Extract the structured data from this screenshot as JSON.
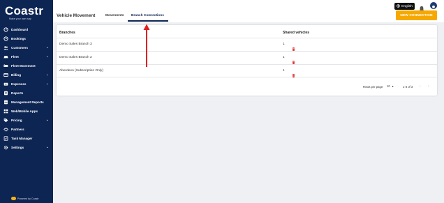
{
  "brand": {
    "name": "Coastr",
    "tagline": "Make your own way"
  },
  "sidebar": {
    "items": [
      {
        "label": "Dashboard",
        "icon": "dashboard-icon",
        "chevron": false
      },
      {
        "label": "Bookings",
        "icon": "bookings-icon",
        "chevron": false
      },
      {
        "label": "Customers",
        "icon": "customers-icon",
        "chevron": true
      },
      {
        "label": "Fleet",
        "icon": "car-icon",
        "chevron": true
      },
      {
        "label": "Fleet Movement",
        "icon": "fleet-movement-icon",
        "chevron": false
      },
      {
        "label": "Billing",
        "icon": "billing-icon",
        "chevron": true
      },
      {
        "label": "Expenses",
        "icon": "expenses-icon",
        "chevron": true
      },
      {
        "label": "Reports",
        "icon": "reports-icon",
        "chevron": false
      },
      {
        "label": "Management Reports",
        "icon": "management-reports-icon",
        "chevron": false
      },
      {
        "label": "Web/Mobile Apps",
        "icon": "apps-icon",
        "chevron": false
      },
      {
        "label": "Pricing",
        "icon": "pricing-tag-icon",
        "chevron": true
      },
      {
        "label": "Partners",
        "icon": "partners-icon",
        "chevron": false
      },
      {
        "label": "Task Manager",
        "icon": "task-manager-icon",
        "chevron": false
      },
      {
        "label": "Settings",
        "icon": "gear-icon",
        "chevron": true
      }
    ],
    "powered_by": "Powered by Coastr"
  },
  "topbar": {
    "language": "English"
  },
  "header": {
    "title": "Vehicle Movement",
    "tabs": [
      {
        "label": "Movements"
      },
      {
        "label": "Branch Connections"
      }
    ],
    "active_tab": "Branch Connections",
    "new_button": "NEW CONNECTION"
  },
  "table": {
    "columns": [
      "Branches",
      "Shared vehicles"
    ],
    "rows": [
      {
        "branch": "Demo Sales Branch 3",
        "shared": "1"
      },
      {
        "branch": "Demo Sales Branch 2",
        "shared": "1"
      },
      {
        "branch": "Aberdeen (Subscription Only)",
        "shared": "1"
      }
    ],
    "footer": {
      "rows_per_page_label": "Rows per page:",
      "rows_per_page": "10",
      "range": "1-3 of 3"
    }
  },
  "colors": {
    "sidebar": "#0d2553",
    "accent": "#f6a800",
    "danger": "#e53935",
    "arrow": "#e02020"
  }
}
